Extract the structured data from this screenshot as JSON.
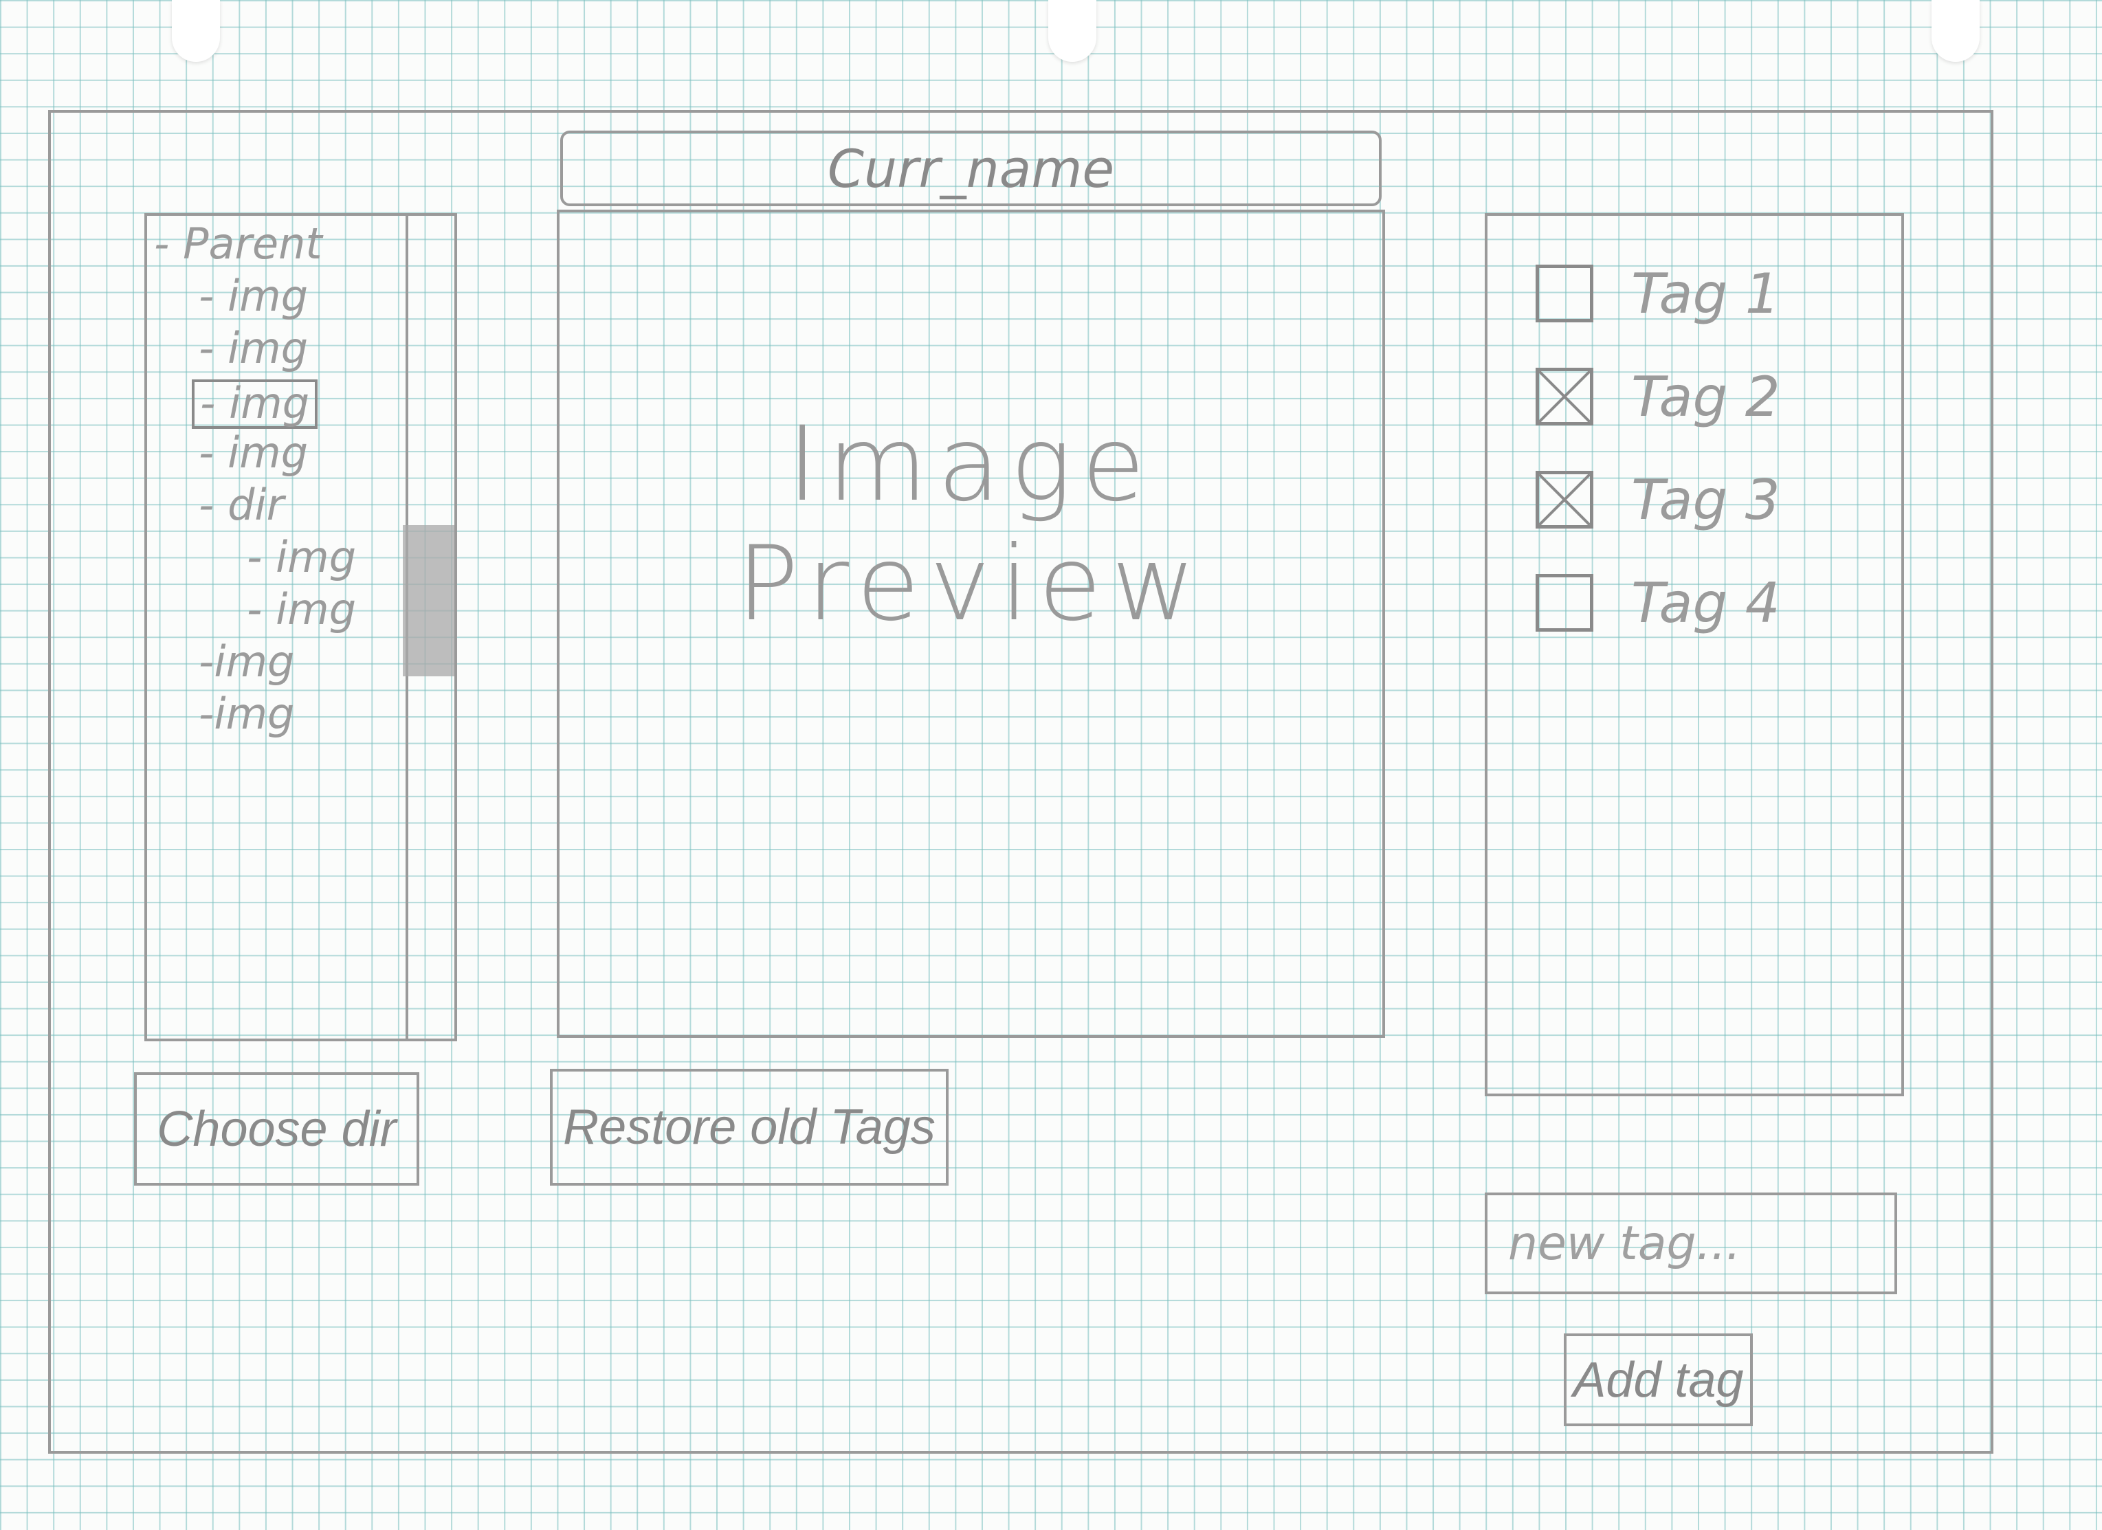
{
  "title_bar": {
    "current_name": "Curr_name"
  },
  "file_tree": {
    "items": [
      {
        "label": "- Parent",
        "depth": 0,
        "selected": false
      },
      {
        "label": "- img",
        "depth": 1,
        "selected": false
      },
      {
        "label": "- img",
        "depth": 1,
        "selected": false
      },
      {
        "label": "- img",
        "depth": 1,
        "selected": true
      },
      {
        "label": "- img",
        "depth": 1,
        "selected": false
      },
      {
        "label": "- dir",
        "depth": 1,
        "selected": false
      },
      {
        "label": "- img",
        "depth": 2,
        "selected": false
      },
      {
        "label": "- img",
        "depth": 2,
        "selected": false
      },
      {
        "label": "-img",
        "depth": 1,
        "selected": false
      },
      {
        "label": "-img",
        "depth": 1,
        "selected": false
      }
    ]
  },
  "preview": {
    "label": "Image Preview"
  },
  "tags": [
    {
      "label": "Tag 1",
      "checked": false
    },
    {
      "label": "Tag 2",
      "checked": true
    },
    {
      "label": "Tag 3",
      "checked": true
    },
    {
      "label": "Tag 4",
      "checked": false
    }
  ],
  "buttons": {
    "choose_dir": "Choose dir",
    "restore_old_tags": "Restore old Tags",
    "add_tag": "Add tag"
  },
  "new_tag": {
    "placeholder": "new tag...",
    "value": ""
  }
}
